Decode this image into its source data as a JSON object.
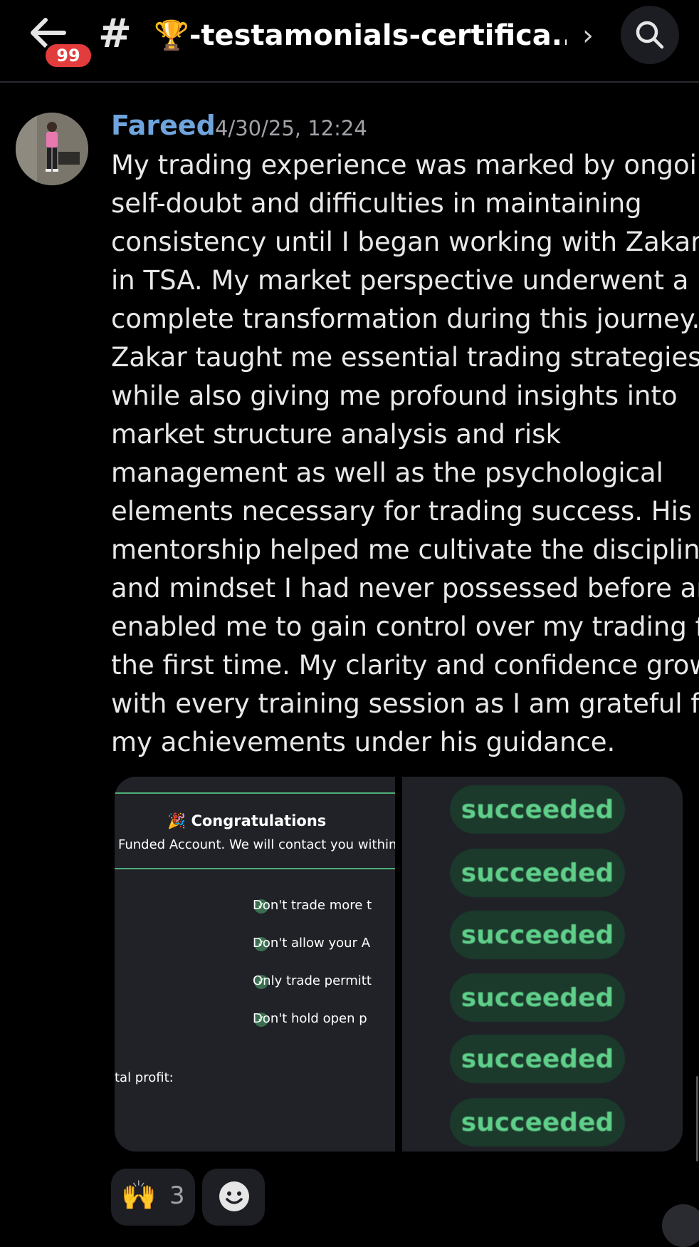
{
  "header": {
    "notification_count": "99",
    "channel_emoji": "🏆",
    "channel_name": "-testamonials-certifica...",
    "hash": "#",
    "chevron": "›"
  },
  "message": {
    "author": "Fareed",
    "timestamp": "4/30/25, 12:24",
    "author_color": "#6fa4dc",
    "lines": [
      "My trading experience was marked by ongoing",
      "self-doubt and difficulties in maintaining",
      "consistency until I began working with Zakar",
      "in TSA. My market perspective underwent a",
      "complete transformation during this journey.",
      "Zakar taught me essential trading strategies",
      "while also giving me profound insights into",
      "market structure analysis and risk",
      "management as well as the psychological",
      "elements necessary for trading success. His",
      "mentorship helped me cultivate the discipline",
      "and mindset I had never possessed before and",
      "enabled me to gain control over my trading for",
      "the first time. My clarity and confidence grow",
      "with every training session as I am grateful for",
      "my achievements under his guidance."
    ]
  },
  "attachment1": {
    "congrats_emoji": "🎉",
    "congrats": "Congratulations",
    "funded": "Funded Account. We will contact you within",
    "rules": [
      "Don't trade more t",
      "Don't allow your A",
      "Only trade permitt",
      "Don't hold open p"
    ],
    "total_profit": "tal profit:"
  },
  "attachment2": {
    "statuses": [
      "succeeded",
      "succeeded",
      "succeeded",
      "succeeded",
      "succeeded",
      "succeeded"
    ],
    "status_color": "#5fcf8a"
  },
  "reactions": {
    "emoji": "🙌",
    "count": "3"
  }
}
